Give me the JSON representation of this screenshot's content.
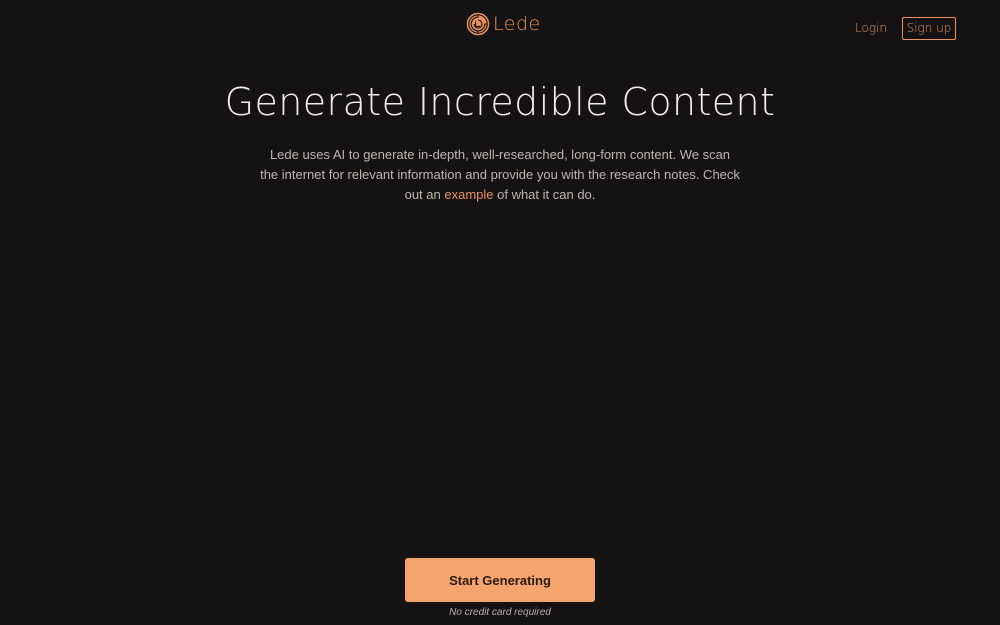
{
  "header": {
    "logo_text": "Lede",
    "logo_icon": "maze-medallion-icon",
    "login_label": "Login",
    "signup_label": "Sign up"
  },
  "hero": {
    "title": "Generate Incredible Content",
    "description_part1": "Lede uses AI to generate in-depth, well-researched, long-form content. We scan the internet for relevant information and provide you with the research notes. Check out an ",
    "example_link": "example",
    "description_part2": " of what it can do."
  },
  "cta": {
    "button_label": "Start Generating",
    "note": "No credit card required"
  },
  "colors": {
    "background": "#141212",
    "accent": "#e8935e",
    "button_fill": "#f5a46d",
    "title_text": "#f2ede9",
    "body_text": "#bdb6b0"
  }
}
